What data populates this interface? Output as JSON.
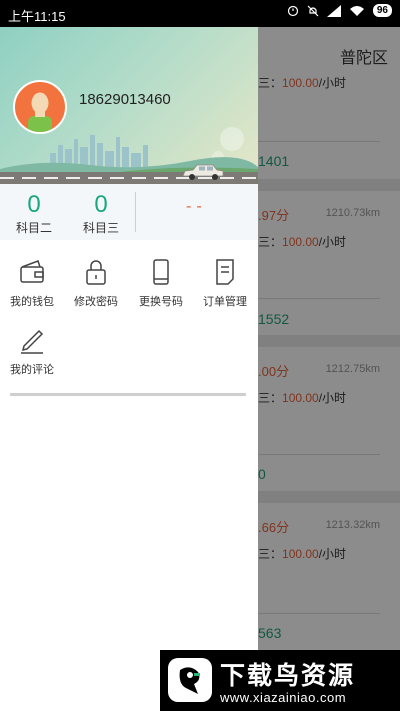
{
  "status_bar": {
    "time": "上午11:15",
    "battery": "96",
    "icons": [
      "alarm-icon",
      "mute-icon",
      "signal-icon",
      "wifi-icon",
      "battery-icon"
    ]
  },
  "background_page": {
    "district": "普陀区",
    "cards": [
      {
        "price_prefix": "三：",
        "price": "100.00",
        "price_unit": "/小时",
        "count": "1401"
      },
      {
        "score": ".97分",
        "distance": "1210.73km",
        "price_prefix": "三：",
        "price": "100.00",
        "price_unit": "/小时",
        "count": "1552"
      },
      {
        "score": ".00分",
        "distance": "1212.75km",
        "price_prefix": "三：",
        "price": "100.00",
        "price_unit": "/小时",
        "count": "0"
      },
      {
        "score": ".66分",
        "distance": "1213.32km",
        "price_prefix": "三：",
        "price": "100.00",
        "price_unit": "/小时",
        "count": "563"
      }
    ]
  },
  "drawer": {
    "phone": "18629013460",
    "stats": [
      {
        "value": "0",
        "label": "科目二"
      },
      {
        "value": "0",
        "label": "科目三"
      }
    ],
    "stat_placeholder": "--",
    "menu": [
      {
        "label": "我的钱包",
        "icon": "wallet-icon"
      },
      {
        "label": "修改密码",
        "icon": "lock-icon"
      },
      {
        "label": "更换号码",
        "icon": "phone-icon"
      },
      {
        "label": "订单管理",
        "icon": "document-icon"
      },
      {
        "label": "我的评论",
        "icon": "pencil-icon"
      }
    ]
  },
  "watermark": {
    "title": "下载鸟资源",
    "url": "www.xiazainiao.com"
  },
  "colors": {
    "accent_green": "#18a77e",
    "accent_orange": "#e8623a",
    "avatar_bg": "#f2733e"
  }
}
